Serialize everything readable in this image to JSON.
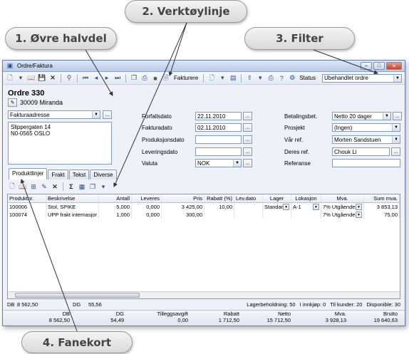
{
  "callouts": {
    "top_half": "1. Øvre halvdel",
    "toolbar": "2. Verktøylinje",
    "filter": "3. Filter",
    "tabs": "4. Fanekort"
  },
  "window": {
    "title": "Ordre/Faktura",
    "controls": [
      "–",
      "□",
      "✕"
    ]
  },
  "toolbar": {
    "invoice_label": "Fakturere",
    "status_label": "Status",
    "status_value": "Ubehandlet ordre"
  },
  "order": {
    "heading": "Ordre 330",
    "customer": "30009 Miranda",
    "address_type": "Fakturaadresse",
    "address_lines": [
      "Slippergaten 14",
      "N0-0565 OSLO"
    ]
  },
  "dates": [
    {
      "label": "Forfallsdato",
      "value": "22.11.2010"
    },
    {
      "label": "Fakturadato",
      "value": "02.11.2010"
    },
    {
      "label": "Produksjonsdato",
      "value": ""
    },
    {
      "label": "Leveringsdato",
      "value": ""
    },
    {
      "label": "Valuta",
      "value": "NOK"
    }
  ],
  "terms": [
    {
      "label": "Betalingsbet.",
      "value": "Netto 20 dager"
    },
    {
      "label": "Prosjekt",
      "value": "(Ingen)"
    },
    {
      "label": "Vår ref.",
      "value": "Morten Sandstuen"
    },
    {
      "label": "Deres ref.",
      "value": "Chouk Li"
    },
    {
      "label": "Referanse",
      "value": ""
    }
  ],
  "tabs": [
    "Produktlinjer",
    "Frakt",
    "Tekst",
    "Diverse"
  ],
  "grid": {
    "columns": [
      "Produktnr.",
      "Beskrivelse",
      "Antall",
      "Leveres",
      "Pris",
      "Rabatt (%)",
      "Lev.dato",
      "Lager",
      "Lokasjon",
      "Mva.",
      "Sum mva."
    ],
    "rows": [
      [
        "100006",
        "Stol, SPIKE",
        "5,000",
        "0,000",
        "3 425,00",
        "10,00",
        "",
        "Standar",
        "A-1",
        "7% Utgående",
        "3 853,13"
      ],
      [
        "100074",
        "UPP frakt internasjor",
        "1,000",
        "0,000",
        "300,00",
        "",
        "",
        "",
        "",
        "7% Utgående",
        "75,00"
      ]
    ]
  },
  "status_line": {
    "db_label": "DB",
    "db_value": "8 562,50",
    "dg_label": "DG",
    "dg_value": "55,56",
    "lagerbeholdning": "Lagerbeholdning: 50",
    "innkjop": "I innkjøp: 0",
    "til_kunder": "Til kunder: 20",
    "disponible": "Disponible: 30"
  },
  "totals": [
    {
      "label": "DB",
      "value": "8 562,50"
    },
    {
      "label": "DG",
      "value": "54,49"
    },
    {
      "label": "Tilleggsavgift",
      "value": "0,00"
    },
    {
      "label": "Rabatt",
      "value": "1 712,50"
    },
    {
      "label": "Netto",
      "value": "15 712,50"
    },
    {
      "label": "Mva.",
      "value": "3 928,13"
    },
    {
      "label": "Brutto",
      "value": "19 640,63"
    }
  ]
}
